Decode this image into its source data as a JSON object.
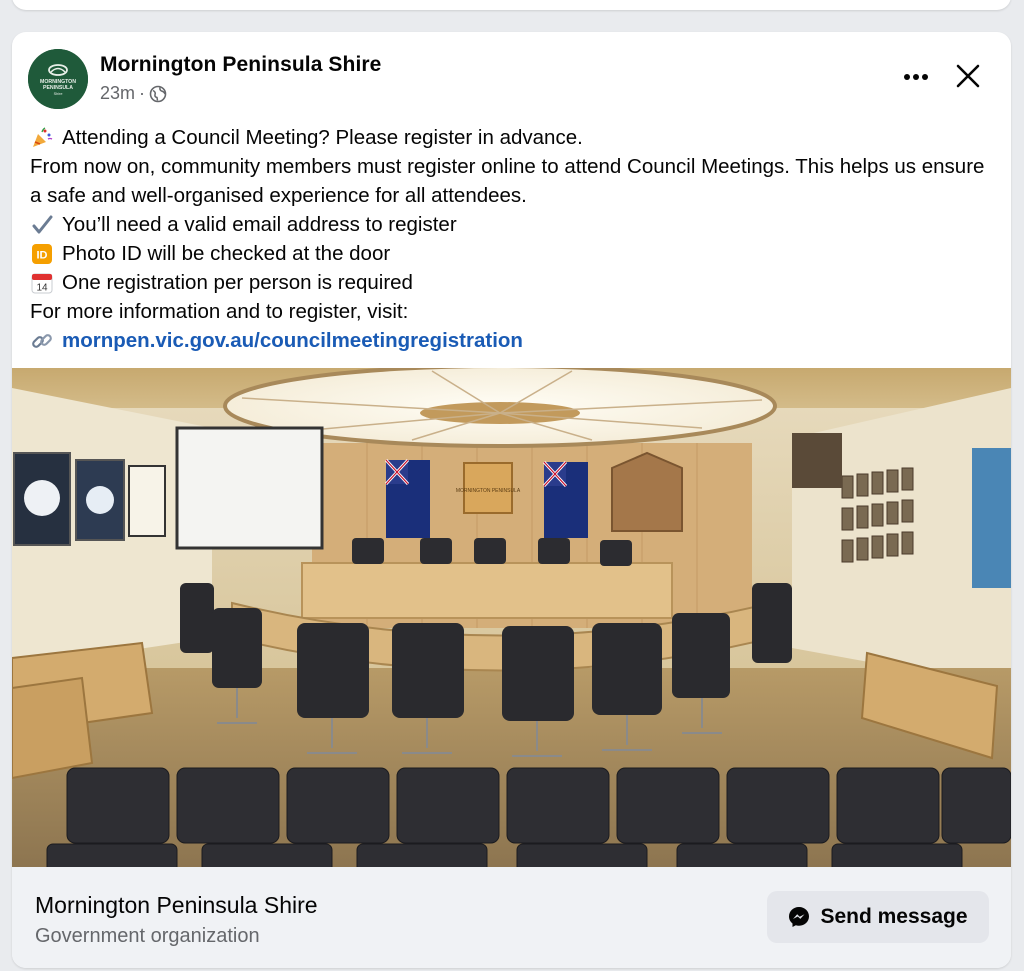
{
  "post": {
    "author": "Mornington Peninsula Shire",
    "time": "23m",
    "separator": "·",
    "avatar_text_top": "MORNINGTON",
    "avatar_text_bottom": "PENINSULA",
    "avatar_text_small": "Shire",
    "lines": {
      "headline": "Attending a Council Meeting? Please register in advance.",
      "paragraph": "From now on, community members must register online to attend Council Meetings. This helps us ensure a safe and well-organised experience for all attendees.",
      "bullet_email": "You’ll need a valid email address to register",
      "bullet_photo_id": "Photo ID will be checked at the door",
      "bullet_one_reg": "One registration per person is required",
      "more_info": "For more information and to register, visit:",
      "link": "mornpen.vic.gov.au/councilmeetingregistration"
    },
    "icons": {
      "headline": "party-popper-icon",
      "email": "check-mark-icon",
      "photo_id": "id-badge-icon",
      "one_reg": "calendar-icon",
      "link": "link-icon",
      "globe": "globe-icon",
      "more": "more-options-icon",
      "close": "close-icon",
      "messenger": "messenger-icon"
    },
    "calendar_day": "14",
    "id_label": "ID",
    "photo_alt": "Council chamber with curved dais, black chairs and Australian flags",
    "photo_sign": "MORNINGTON PENINSULA"
  },
  "footer": {
    "name": "Mornington Peninsula Shire",
    "category": "Government organization",
    "send_label": "Send message"
  },
  "colors": {
    "brand_green": "#1f5a3a",
    "link": "#1a5bb5",
    "secondary_text": "#65676b",
    "button_bg": "#e4e6eb"
  }
}
